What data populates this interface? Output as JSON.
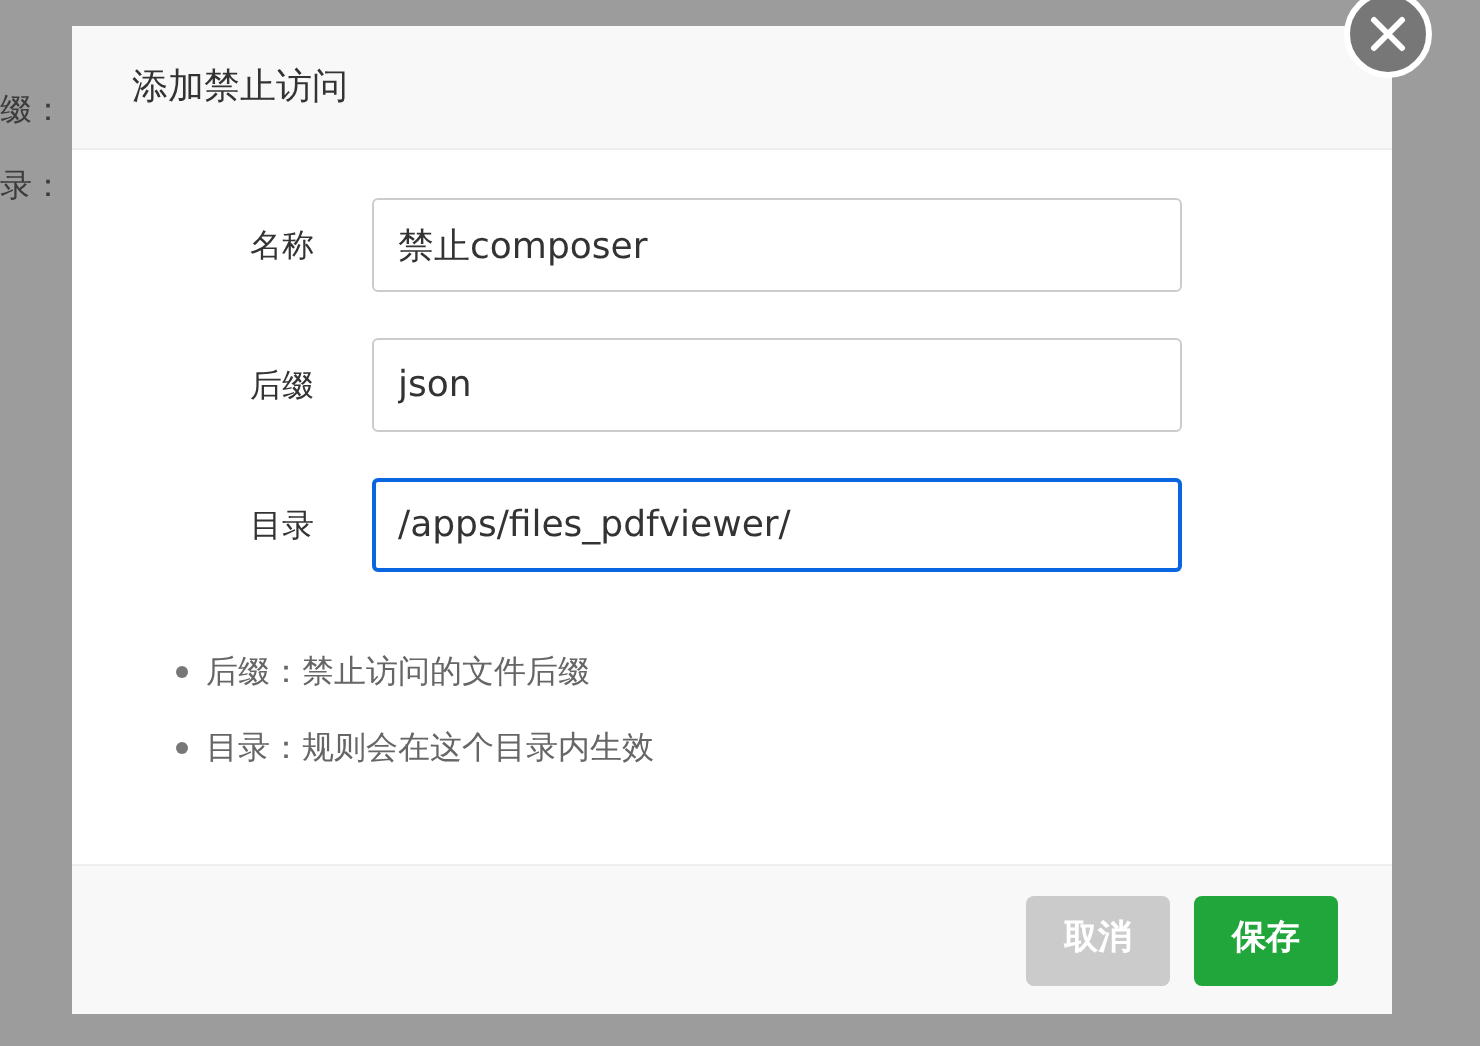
{
  "background": {
    "lines": [
      "缀：",
      "录："
    ]
  },
  "dialog": {
    "title": "添加禁止访问",
    "fields": [
      {
        "label": "名称",
        "value": "禁止composer",
        "focused": false
      },
      {
        "label": "后缀",
        "value": "json",
        "focused": false
      },
      {
        "label": "目录",
        "value": "/apps/files_pdfviewer/",
        "focused": true
      }
    ],
    "notes": [
      "后缀：禁止访问的文件后缀",
      "目录：规则会在这个目录内生效"
    ],
    "buttons": [
      {
        "label": "取消",
        "kind": "secondary"
      },
      {
        "label": "保存",
        "kind": "primary"
      }
    ]
  }
}
